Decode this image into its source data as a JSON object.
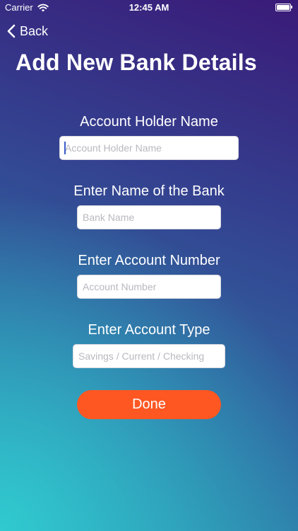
{
  "status_bar": {
    "carrier": "Carrier",
    "time": "12:45 AM"
  },
  "nav": {
    "back_label": "Back"
  },
  "page": {
    "title": "Add New Bank Details"
  },
  "form": {
    "account_holder": {
      "label": "Account Holder Name",
      "placeholder": "Account Holder Name",
      "value": ""
    },
    "bank_name": {
      "label": "Enter Name of the Bank",
      "placeholder": "Bank Name",
      "value": ""
    },
    "account_number": {
      "label": "Enter Account Number",
      "placeholder": "Account Number",
      "value": ""
    },
    "account_type": {
      "label": "Enter Account Type",
      "placeholder": "Savings / Current / Checking",
      "value": ""
    },
    "done_label": "Done"
  },
  "colors": {
    "done_button": "#ff5722",
    "background_top": "#3a1a78",
    "background_bottom": "#30cdd2"
  }
}
